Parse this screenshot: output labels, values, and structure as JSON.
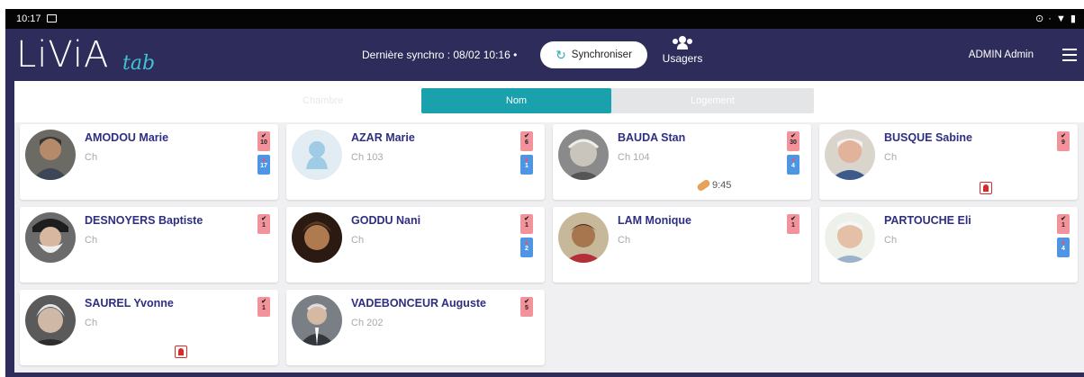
{
  "status_bar": {
    "time": "10:17",
    "system_icons": "⊙ · ▼ ▮"
  },
  "header": {
    "logo_main": "LiViA",
    "logo_sub": "tab",
    "last_sync": "Dernière synchro : 08/02 10:16 •",
    "sync_button": "Synchroniser",
    "usagers_label": "Usagers",
    "user_name": "ADMIN Admin"
  },
  "tabs": {
    "left_placeholder": "Chambre",
    "nom": "Nom",
    "logement": "Logement",
    "active": "Nom"
  },
  "colors": {
    "header_bg": "#2e2c5a",
    "accent": "#1aa1ae",
    "name_text": "#2f2e82",
    "badge_pink": "#f2929a",
    "badge_blue": "#4e96e3",
    "alert_red": "#d82a2a"
  },
  "residents": [
    {
      "name": "AMODOU Marie",
      "room": "Ch",
      "avatar": "photo",
      "badge_check": "10",
      "badge_blue": "17"
    },
    {
      "name": "AZAR Marie",
      "room": "Ch 103",
      "avatar": "placeholder-silhouette",
      "badge_check": "6",
      "badge_blue": "1"
    },
    {
      "name": "BAUDA Stan",
      "room": "Ch 104",
      "avatar": "photo",
      "badge_check": "30",
      "badge_blue": "4",
      "med_time": "9:45"
    },
    {
      "name": "BUSQUE Sabine",
      "room": "Ch",
      "avatar": "photo",
      "badge_check": "9",
      "alert": true
    },
    {
      "name": "DESNOYERS Baptiste",
      "room": "Ch",
      "avatar": "photo",
      "badge_check": "1"
    },
    {
      "name": "GODDU Nani",
      "room": "Ch",
      "avatar": "photo",
      "badge_check": "1",
      "badge_blue": "2"
    },
    {
      "name": "LAM Monique",
      "room": "Ch",
      "avatar": "photo",
      "badge_check": "1"
    },
    {
      "name": "PARTOUCHE Eli",
      "room": "Ch",
      "avatar": "photo",
      "badge_check": "1",
      "badge_blue": "4"
    },
    {
      "name": "SAUREL Yvonne",
      "room": "Ch",
      "avatar": "photo",
      "badge_check": "1",
      "alert": true
    },
    {
      "name": "VADEBONCEUR Auguste",
      "room": "Ch 202",
      "avatar": "photo",
      "badge_check": "5"
    }
  ]
}
